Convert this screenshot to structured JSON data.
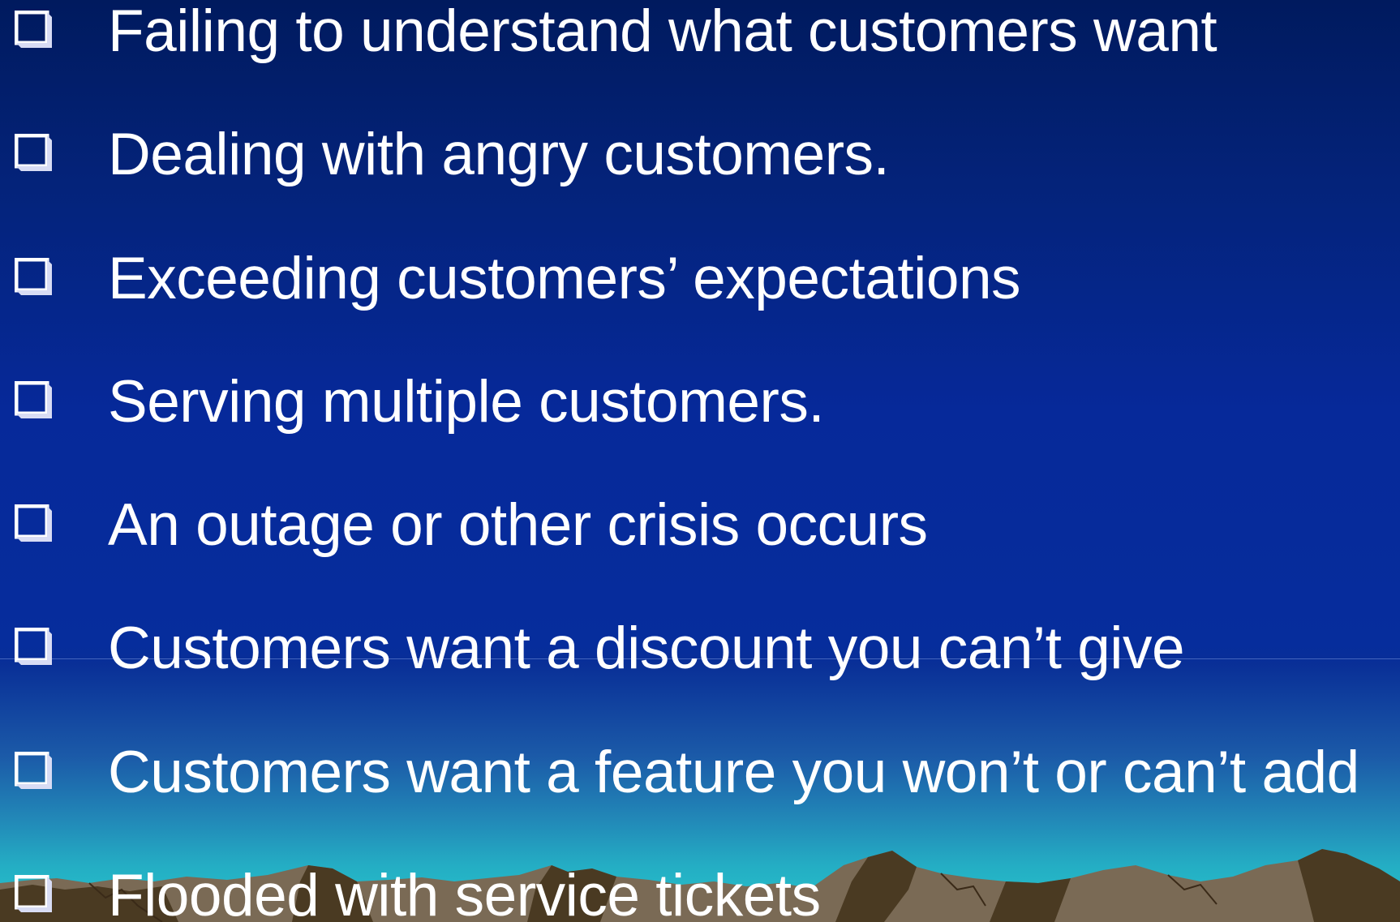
{
  "bullets": [
    {
      "text": "Failing to understand what customers want"
    },
    {
      "text": "Dealing with angry customers."
    },
    {
      "text": "Exceeding customers’ expectations"
    },
    {
      "text": "Serving multiple customers."
    },
    {
      "text": "An outage or other crisis occurs"
    },
    {
      "text": "Customers want a discount you can’t give"
    },
    {
      "text": "Customers want a feature you won’t or can’t add"
    },
    {
      "text": "Flooded with service tickets"
    }
  ],
  "colors": {
    "text": "#ffffff",
    "sky_top": "#001a5e",
    "sky_mid": "#062d9c",
    "horizon_glow": "#27c6cc",
    "mountain": "#7a6a55",
    "mountain_shadow": "#4a3a22"
  },
  "icons": {
    "bullet": "checkbox-icon",
    "scenery": "mountain-range"
  }
}
